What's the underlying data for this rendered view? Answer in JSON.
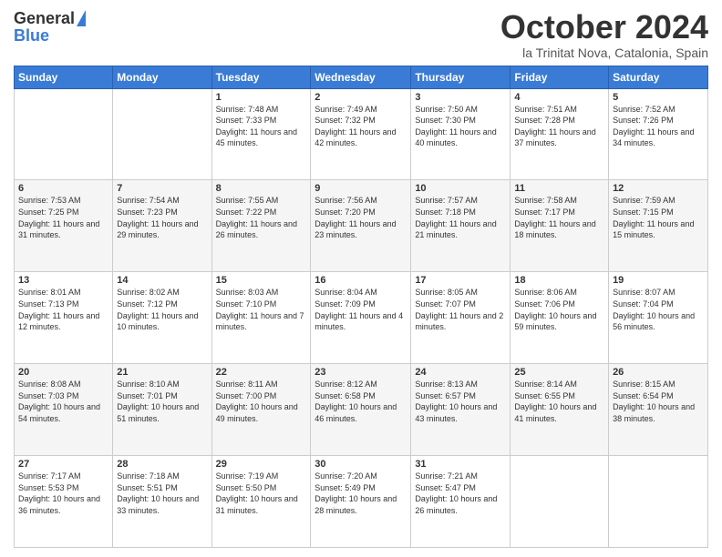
{
  "header": {
    "logo_line1": "General",
    "logo_line2": "Blue",
    "month": "October 2024",
    "location": "la Trinitat Nova, Catalonia, Spain"
  },
  "weekdays": [
    "Sunday",
    "Monday",
    "Tuesday",
    "Wednesday",
    "Thursday",
    "Friday",
    "Saturday"
  ],
  "weeks": [
    [
      {
        "day": "",
        "sunrise": "",
        "sunset": "",
        "daylight": ""
      },
      {
        "day": "",
        "sunrise": "",
        "sunset": "",
        "daylight": ""
      },
      {
        "day": "1",
        "sunrise": "Sunrise: 7:48 AM",
        "sunset": "Sunset: 7:33 PM",
        "daylight": "Daylight: 11 hours and 45 minutes."
      },
      {
        "day": "2",
        "sunrise": "Sunrise: 7:49 AM",
        "sunset": "Sunset: 7:32 PM",
        "daylight": "Daylight: 11 hours and 42 minutes."
      },
      {
        "day": "3",
        "sunrise": "Sunrise: 7:50 AM",
        "sunset": "Sunset: 7:30 PM",
        "daylight": "Daylight: 11 hours and 40 minutes."
      },
      {
        "day": "4",
        "sunrise": "Sunrise: 7:51 AM",
        "sunset": "Sunset: 7:28 PM",
        "daylight": "Daylight: 11 hours and 37 minutes."
      },
      {
        "day": "5",
        "sunrise": "Sunrise: 7:52 AM",
        "sunset": "Sunset: 7:26 PM",
        "daylight": "Daylight: 11 hours and 34 minutes."
      }
    ],
    [
      {
        "day": "6",
        "sunrise": "Sunrise: 7:53 AM",
        "sunset": "Sunset: 7:25 PM",
        "daylight": "Daylight: 11 hours and 31 minutes."
      },
      {
        "day": "7",
        "sunrise": "Sunrise: 7:54 AM",
        "sunset": "Sunset: 7:23 PM",
        "daylight": "Daylight: 11 hours and 29 minutes."
      },
      {
        "day": "8",
        "sunrise": "Sunrise: 7:55 AM",
        "sunset": "Sunset: 7:22 PM",
        "daylight": "Daylight: 11 hours and 26 minutes."
      },
      {
        "day": "9",
        "sunrise": "Sunrise: 7:56 AM",
        "sunset": "Sunset: 7:20 PM",
        "daylight": "Daylight: 11 hours and 23 minutes."
      },
      {
        "day": "10",
        "sunrise": "Sunrise: 7:57 AM",
        "sunset": "Sunset: 7:18 PM",
        "daylight": "Daylight: 11 hours and 21 minutes."
      },
      {
        "day": "11",
        "sunrise": "Sunrise: 7:58 AM",
        "sunset": "Sunset: 7:17 PM",
        "daylight": "Daylight: 11 hours and 18 minutes."
      },
      {
        "day": "12",
        "sunrise": "Sunrise: 7:59 AM",
        "sunset": "Sunset: 7:15 PM",
        "daylight": "Daylight: 11 hours and 15 minutes."
      }
    ],
    [
      {
        "day": "13",
        "sunrise": "Sunrise: 8:01 AM",
        "sunset": "Sunset: 7:13 PM",
        "daylight": "Daylight: 11 hours and 12 minutes."
      },
      {
        "day": "14",
        "sunrise": "Sunrise: 8:02 AM",
        "sunset": "Sunset: 7:12 PM",
        "daylight": "Daylight: 11 hours and 10 minutes."
      },
      {
        "day": "15",
        "sunrise": "Sunrise: 8:03 AM",
        "sunset": "Sunset: 7:10 PM",
        "daylight": "Daylight: 11 hours and 7 minutes."
      },
      {
        "day": "16",
        "sunrise": "Sunrise: 8:04 AM",
        "sunset": "Sunset: 7:09 PM",
        "daylight": "Daylight: 11 hours and 4 minutes."
      },
      {
        "day": "17",
        "sunrise": "Sunrise: 8:05 AM",
        "sunset": "Sunset: 7:07 PM",
        "daylight": "Daylight: 11 hours and 2 minutes."
      },
      {
        "day": "18",
        "sunrise": "Sunrise: 8:06 AM",
        "sunset": "Sunset: 7:06 PM",
        "daylight": "Daylight: 10 hours and 59 minutes."
      },
      {
        "day": "19",
        "sunrise": "Sunrise: 8:07 AM",
        "sunset": "Sunset: 7:04 PM",
        "daylight": "Daylight: 10 hours and 56 minutes."
      }
    ],
    [
      {
        "day": "20",
        "sunrise": "Sunrise: 8:08 AM",
        "sunset": "Sunset: 7:03 PM",
        "daylight": "Daylight: 10 hours and 54 minutes."
      },
      {
        "day": "21",
        "sunrise": "Sunrise: 8:10 AM",
        "sunset": "Sunset: 7:01 PM",
        "daylight": "Daylight: 10 hours and 51 minutes."
      },
      {
        "day": "22",
        "sunrise": "Sunrise: 8:11 AM",
        "sunset": "Sunset: 7:00 PM",
        "daylight": "Daylight: 10 hours and 49 minutes."
      },
      {
        "day": "23",
        "sunrise": "Sunrise: 8:12 AM",
        "sunset": "Sunset: 6:58 PM",
        "daylight": "Daylight: 10 hours and 46 minutes."
      },
      {
        "day": "24",
        "sunrise": "Sunrise: 8:13 AM",
        "sunset": "Sunset: 6:57 PM",
        "daylight": "Daylight: 10 hours and 43 minutes."
      },
      {
        "day": "25",
        "sunrise": "Sunrise: 8:14 AM",
        "sunset": "Sunset: 6:55 PM",
        "daylight": "Daylight: 10 hours and 41 minutes."
      },
      {
        "day": "26",
        "sunrise": "Sunrise: 8:15 AM",
        "sunset": "Sunset: 6:54 PM",
        "daylight": "Daylight: 10 hours and 38 minutes."
      }
    ],
    [
      {
        "day": "27",
        "sunrise": "Sunrise: 7:17 AM",
        "sunset": "Sunset: 5:53 PM",
        "daylight": "Daylight: 10 hours and 36 minutes."
      },
      {
        "day": "28",
        "sunrise": "Sunrise: 7:18 AM",
        "sunset": "Sunset: 5:51 PM",
        "daylight": "Daylight: 10 hours and 33 minutes."
      },
      {
        "day": "29",
        "sunrise": "Sunrise: 7:19 AM",
        "sunset": "Sunset: 5:50 PM",
        "daylight": "Daylight: 10 hours and 31 minutes."
      },
      {
        "day": "30",
        "sunrise": "Sunrise: 7:20 AM",
        "sunset": "Sunset: 5:49 PM",
        "daylight": "Daylight: 10 hours and 28 minutes."
      },
      {
        "day": "31",
        "sunrise": "Sunrise: 7:21 AM",
        "sunset": "Sunset: 5:47 PM",
        "daylight": "Daylight: 10 hours and 26 minutes."
      },
      {
        "day": "",
        "sunrise": "",
        "sunset": "",
        "daylight": ""
      },
      {
        "day": "",
        "sunrise": "",
        "sunset": "",
        "daylight": ""
      }
    ]
  ]
}
